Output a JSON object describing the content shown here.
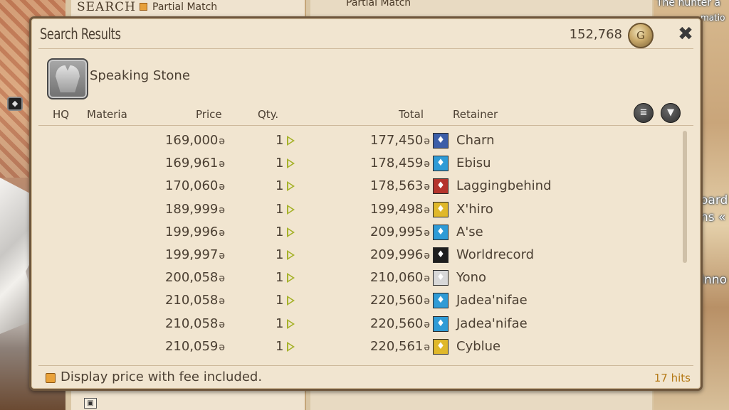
{
  "background": {
    "search_label": "SEARCH",
    "partial_match_left": "Partial Match",
    "partial_match_right": "Partial Match",
    "overlay_text_1": "The hunter a",
    "overlay_text_2": "matio",
    "overlay_text_3": "oard",
    "overlay_text_4": "ns «",
    "overlay_text_5": "Inno"
  },
  "window": {
    "title": "Search Results",
    "gil_amount": "152,768",
    "gil_icon": "gil-coin-icon",
    "close_icon": "close-icon"
  },
  "item": {
    "name": "Speaking Stone",
    "icon": "speaking-stone-icon"
  },
  "columns": {
    "hq": "HQ",
    "materia": "Materia",
    "price": "Price",
    "qty": "Qty.",
    "total": "Total",
    "retainer": "Retainer"
  },
  "gil_symbol": "ə",
  "listings": [
    {
      "price": "169,000",
      "qty": "1",
      "total": "177,450",
      "retainer": "Charn",
      "retainer_icon": "limsa-icon",
      "icon_color": "#3c5ea8"
    },
    {
      "price": "169,961",
      "qty": "1",
      "total": "178,459",
      "retainer": "Ebisu",
      "retainer_icon": "uldah-icon",
      "icon_color": "#2f9bd6"
    },
    {
      "price": "170,060",
      "qty": "1",
      "total": "178,563",
      "retainer": "Laggingbehind",
      "retainer_icon": "gridania-icon",
      "icon_color": "#b5342c"
    },
    {
      "price": "189,999",
      "qty": "1",
      "total": "199,498",
      "retainer": "X'hiro",
      "retainer_icon": "goldsaucer-icon",
      "icon_color": "#e0b82a"
    },
    {
      "price": "199,996",
      "qty": "1",
      "total": "209,995",
      "retainer": "A'se",
      "retainer_icon": "uldah-icon",
      "icon_color": "#2f9bd6"
    },
    {
      "price": "199,997",
      "qty": "1",
      "total": "209,996",
      "retainer": "Worldrecord",
      "retainer_icon": "kugane-icon",
      "icon_color": "#1e1e1e"
    },
    {
      "price": "200,058",
      "qty": "1",
      "total": "210,060",
      "retainer": "Yono",
      "retainer_icon": "ishgard-icon",
      "icon_color": "#d8d8d8"
    },
    {
      "price": "210,058",
      "qty": "1",
      "total": "220,560",
      "retainer": "Jadea'nifae",
      "retainer_icon": "uldah-icon",
      "icon_color": "#2f9bd6"
    },
    {
      "price": "210,058",
      "qty": "1",
      "total": "220,560",
      "retainer": "Jadea'nifae",
      "retainer_icon": "uldah-icon",
      "icon_color": "#2f9bd6"
    },
    {
      "price": "210,059",
      "qty": "1",
      "total": "220,561",
      "retainer": "Cyblue",
      "retainer_icon": "goldsaucer-icon",
      "icon_color": "#e0b82a"
    }
  ],
  "footer": {
    "fee_label": "Display price with fee included.",
    "hits": "17 hits"
  },
  "colors": {
    "window_bg": "#f1e5d0",
    "text": "#4c4033",
    "checkbox": "#e9a23a",
    "hits": "#b57a18",
    "qty_arrow": "#a6b22a"
  }
}
